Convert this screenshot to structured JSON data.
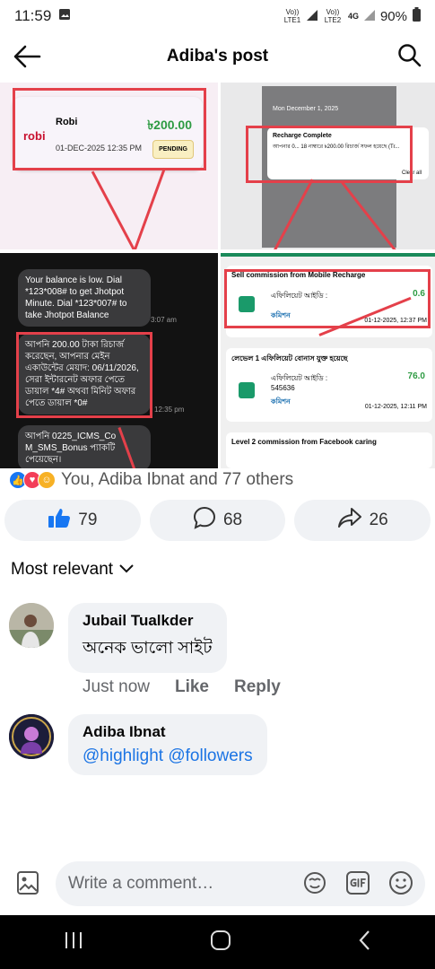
{
  "status_bar": {
    "time": "11:59",
    "battery": "90%",
    "net1": "Vo)) LTE1",
    "net2": "Vo)) LTE2",
    "net_type": "4G"
  },
  "header": {
    "title": "Adiba's post"
  },
  "post_images": {
    "robi": {
      "logo": "robi",
      "name": "Robi",
      "date": "01-DEC-2025 12:35 PM",
      "amount": "৳200.00",
      "status": "PENDING"
    },
    "phone": {
      "date": "Mon December 1, 2025",
      "notif_title": "Recharge Complete",
      "notif_body": "আপনার 0... 18 নাম্বারে ৳200.00 রিচার্জ সফল হয়েছে (Tr...",
      "clear_all": "Clear all"
    },
    "sms": {
      "msg1": "Your balance is low. Dial *123*008# to get Jhotpot Minute. Dial *123*007# to take Jhotpot Balance",
      "time1": "3:07 am",
      "msg2": "আপনি 200.00 টাকা রিচার্জ করেছেন, আপনার মেইন একাউন্টের মেয়াদ: 06/11/2026, সেরা ইন্টারনেট অফার পেতে ডায়াল *4# অথবা মিনিট অফার পেতে ডায়াল *0#",
      "time2": "12:35 pm",
      "msg3": "আপনি 0225_ICMS_Co M_SMS_Bonus প্যাকটি পেয়েছেন।"
    },
    "commission": {
      "c1_title": "Sell commission from Mobile Recharge",
      "c1_label": "এফিলিয়েট আইডি :",
      "c1_value": "0.6",
      "c1_sub": "কমিশন",
      "c1_date": "01-12-2025, 12:37 PM",
      "c2_title": "লেভেল 1 এফিলিয়েট বোনাস যুক্ত হয়েছে",
      "c2_label": "এফিলিয়েট আইডি :",
      "c2_id": "545636",
      "c2_value": "76.0",
      "c2_sub": "কমিশন",
      "c2_date": "01-12-2025, 12:11 PM",
      "c3_title": "Level 2 commission from Facebook caring"
    }
  },
  "reactions": {
    "text": "You, Adiba Ibnat and 77 others"
  },
  "actions": {
    "like_count": "79",
    "comment_count": "68",
    "share_count": "26"
  },
  "sort": {
    "label": "Most relevant"
  },
  "comments": [
    {
      "name": "Jubail Tualkder",
      "text": "অনেক ভালো সাইট",
      "time": "Just now",
      "like": "Like",
      "reply": "Reply"
    },
    {
      "name": "Adiba Ibnat",
      "tag1": "@highlight",
      "tag2": "@followers"
    }
  ],
  "composer": {
    "placeholder": "Write a comment…"
  },
  "colors": {
    "accent": "#1877f2",
    "red_box": "#e4404a",
    "like_blue": "#1877f2"
  }
}
